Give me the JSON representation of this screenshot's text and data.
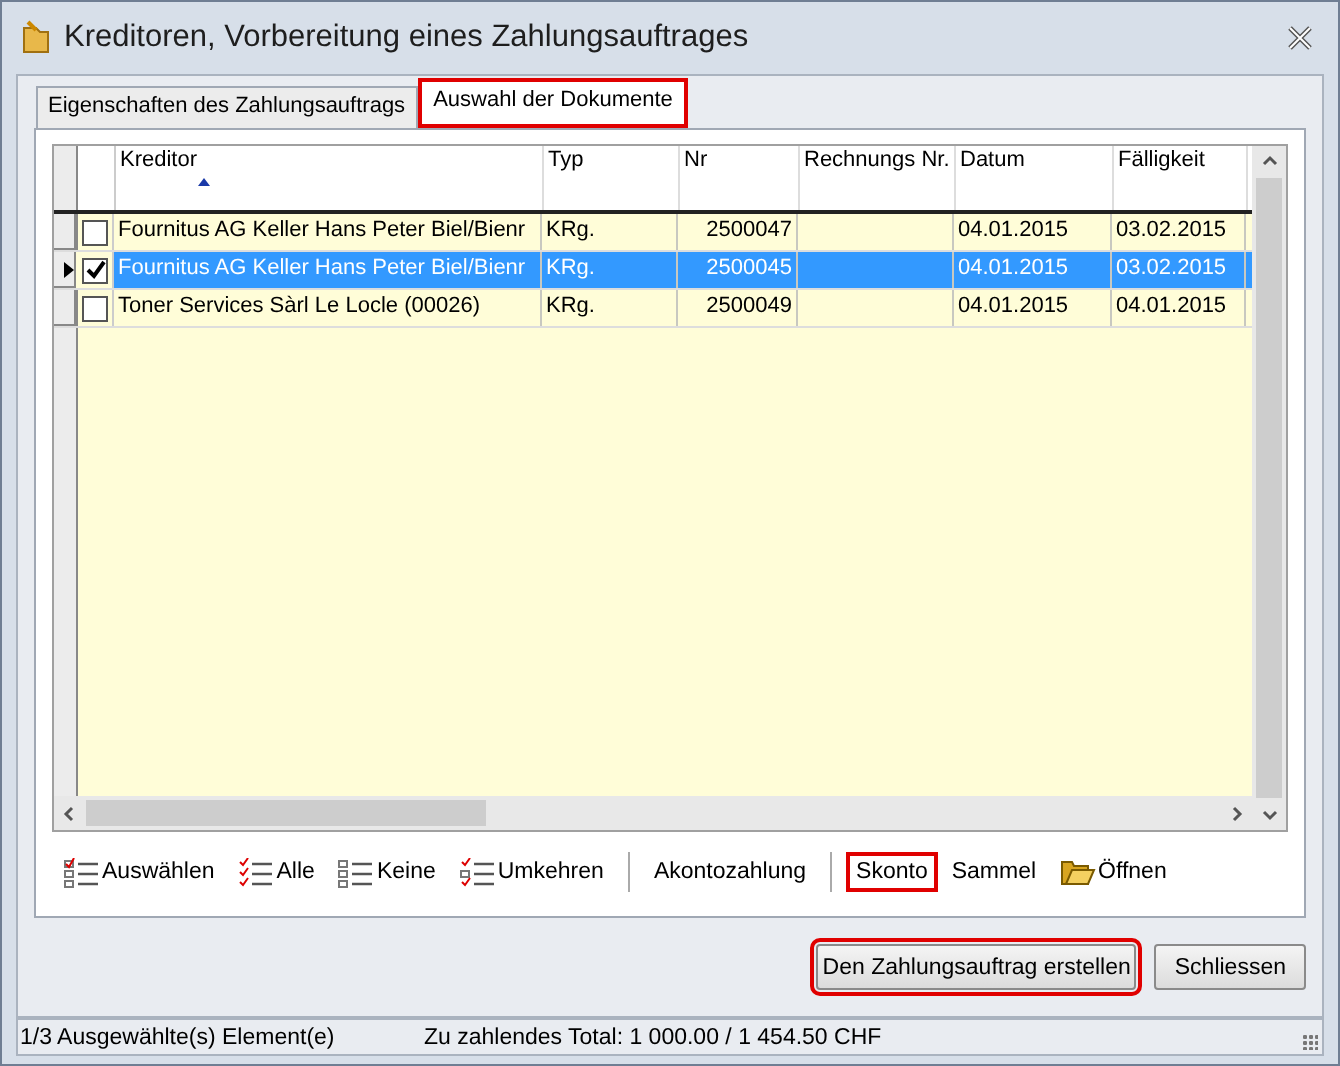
{
  "window": {
    "title": "Kreditoren, Vorbereitung eines Zahlungsauftrages"
  },
  "tabs": [
    {
      "label": "Eigenschaften des Zahlungsauftrags",
      "selected": false,
      "highlighted": false
    },
    {
      "label": "Auswahl der Dokumente",
      "selected": true,
      "highlighted": true
    }
  ],
  "table": {
    "columns": [
      "Kreditor",
      "Typ",
      "Nr",
      "Rechnungs Nr.",
      "Datum",
      "Fälligkeit"
    ],
    "rows": [
      {
        "checked": false,
        "selected": false,
        "cells": [
          "Fournitus AG Keller Hans Peter Biel/Bienr",
          "KRg.",
          "2500047",
          "",
          "04.01.2015",
          "03.02.2015"
        ]
      },
      {
        "checked": true,
        "selected": true,
        "cells": [
          "Fournitus AG Keller Hans Peter Biel/Bienr",
          "KRg.",
          "2500045",
          "",
          "04.01.2015",
          "03.02.2015"
        ]
      },
      {
        "checked": false,
        "selected": false,
        "cells": [
          "Toner Services Sàrl Le Locle (00026)",
          "KRg.",
          "2500049",
          "",
          "04.01.2015",
          "04.01.2015"
        ]
      }
    ]
  },
  "toolbar": [
    {
      "kind": "select",
      "label": "Auswählen",
      "highlighted": false
    },
    {
      "kind": "all",
      "label": "Alle",
      "highlighted": false
    },
    {
      "kind": "none",
      "label": "Keine",
      "highlighted": false
    },
    {
      "kind": "invert",
      "label": "Umkehren",
      "highlighted": false
    },
    {
      "kind": "separator"
    },
    {
      "kind": "text",
      "label": "Akontozahlung",
      "highlighted": false
    },
    {
      "kind": "separator"
    },
    {
      "kind": "text",
      "label": "Skonto",
      "highlighted": true
    },
    {
      "kind": "text",
      "label": "Sammel",
      "highlighted": false
    },
    {
      "kind": "open",
      "label": "Öffnen",
      "highlighted": false
    }
  ],
  "buttons": [
    {
      "label": "Den Zahlungsauftrag erstellen",
      "highlighted": true
    },
    {
      "label": "Schliessen",
      "highlighted": false
    }
  ],
  "status_bar": [
    "1/3 Ausgewählte(s) Element(e)",
    "Zu zahlendes Total: 1 000.00 / 1 454.50 CHF"
  ]
}
